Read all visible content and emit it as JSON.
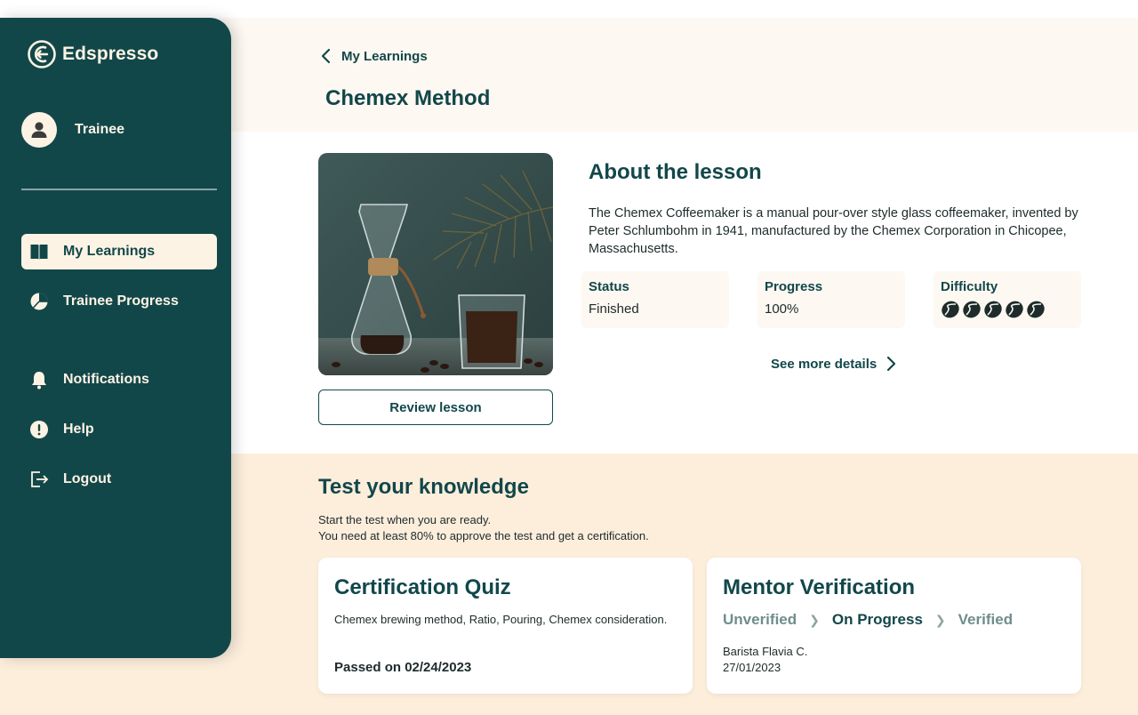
{
  "app": {
    "name": "Edspresso"
  },
  "user": {
    "name": "Trainee"
  },
  "sidebar": {
    "items": [
      {
        "label": "My Learnings",
        "icon": "book-icon",
        "active": true
      },
      {
        "label": "Trainee Progress",
        "icon": "pie-chart-icon",
        "active": false
      },
      {
        "label": "Notifications",
        "icon": "bell-icon",
        "active": false
      },
      {
        "label": "Help",
        "icon": "alert-circle-icon",
        "active": false
      },
      {
        "label": "Logout",
        "icon": "logout-icon",
        "active": false
      }
    ]
  },
  "header": {
    "back_label": "My Learnings",
    "title": "Chemex Method"
  },
  "lesson": {
    "review_button": "Review lesson",
    "about_title": "About the lesson",
    "about_text": "The Chemex Coffeemaker is a manual pour-over style glass coffeemaker, invented by Peter Schlumbohm in 1941, manufactured by the Chemex Corporation in Chicopee, Massachusetts.",
    "status_label": "Status",
    "status_value": "Finished",
    "progress_label": "Progress",
    "progress_value": "100%",
    "difficulty_label": "Difficulty",
    "difficulty_level": 5,
    "difficulty_max": 5,
    "see_more": "See more details"
  },
  "test": {
    "title": "Test your knowledge",
    "desc_line1": "Start the test when you are ready.",
    "desc_line2": "You need at least 80% to approve the test and get a certification.",
    "quiz": {
      "title": "Certification Quiz",
      "topics": "Chemex brewing method, Ratio, Pouring, Chemex consideration.",
      "passed": "Passed on 02/24/2023"
    },
    "mentor": {
      "title": "Mentor Verification",
      "steps": [
        "Unverified",
        "On Progress",
        "Verified"
      ],
      "current_step": 1,
      "mentor_name": "Barista Flavia C.",
      "date": "27/01/2023"
    }
  },
  "colors": {
    "primary": "#12474a",
    "cream": "#fdf3e4",
    "peach_band": "#fdeedc",
    "light_band": "#fdf8f1"
  }
}
